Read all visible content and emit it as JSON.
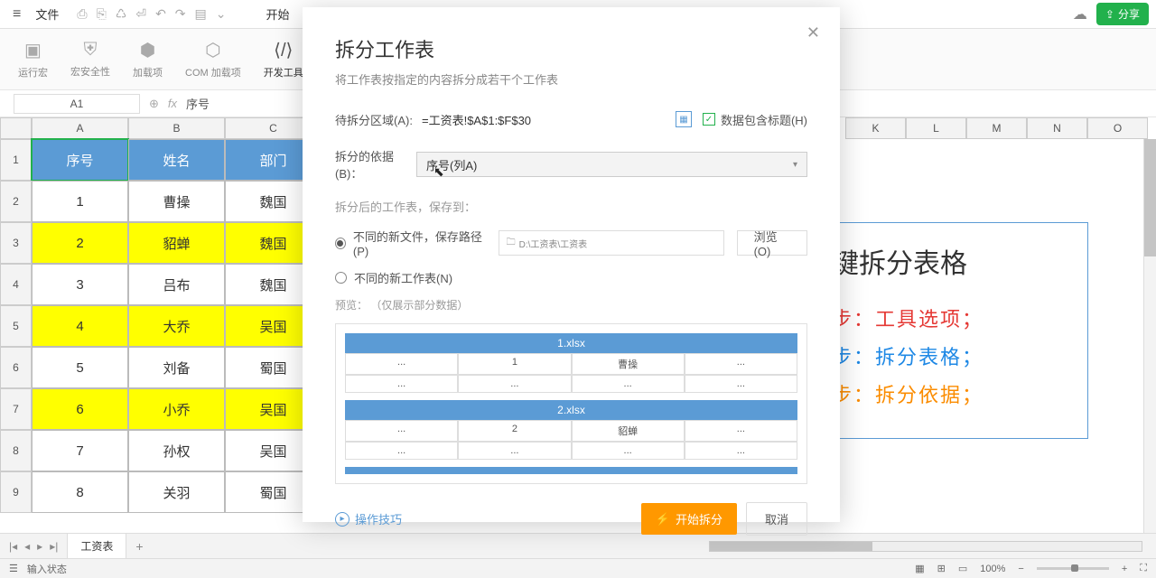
{
  "menubar": {
    "file": "文件",
    "start_tab": "开始",
    "share": "分享"
  },
  "ribbon": {
    "items": [
      {
        "label": "运行宏"
      },
      {
        "label": "宏安全性"
      },
      {
        "label": "加载项"
      },
      {
        "label": "COM 加载项"
      },
      {
        "label": "开发工具"
      }
    ]
  },
  "formula": {
    "name_box": "A1",
    "fx_label": "fx",
    "value": "序号"
  },
  "sheet": {
    "col_letters": [
      "A",
      "B",
      "C"
    ],
    "far_cols": [
      "K",
      "L",
      "M",
      "N",
      "O"
    ],
    "header_row": [
      "序号",
      "姓名",
      "部门"
    ],
    "rows": [
      {
        "n": 1,
        "cells": [
          "1",
          "曹操",
          "魏国"
        ],
        "yellow": false
      },
      {
        "n": 2,
        "cells": [
          "2",
          "貂蝉",
          "魏国"
        ],
        "yellow": true
      },
      {
        "n": 3,
        "cells": [
          "3",
          "吕布",
          "魏国"
        ],
        "yellow": false
      },
      {
        "n": 4,
        "cells": [
          "4",
          "大乔",
          "吴国"
        ],
        "yellow": true
      },
      {
        "n": 5,
        "cells": [
          "5",
          "刘备",
          "蜀国"
        ],
        "yellow": false
      },
      {
        "n": 6,
        "cells": [
          "6",
          "小乔",
          "吴国"
        ],
        "yellow": true
      },
      {
        "n": 7,
        "cells": [
          "7",
          "孙权",
          "吴国"
        ],
        "yellow": false
      },
      {
        "n": 8,
        "cells": [
          "8",
          "关羽",
          "蜀国"
        ],
        "yellow": false
      }
    ]
  },
  "annotation": {
    "title": "键拆分表格",
    "line1": "步：工具选项；",
    "line2": "步：拆分表格；",
    "line3": "步：拆分依据；"
  },
  "tabs": {
    "active": "工资表"
  },
  "status": {
    "left_icon": "☰",
    "text": "输入状态",
    "zoom": "100%"
  },
  "dialog": {
    "title": "拆分工作表",
    "subtitle": "将工作表按指定的内容拆分成若干个工作表",
    "range_label": "待拆分区域(A):",
    "range_value": "=工资表!$A$1:$F$30",
    "contains_header": "数据包含标题(H)",
    "basis_label": "拆分的依据(B)：",
    "basis_value": "序号(列A)",
    "save_to_label": "拆分后的工作表，保存到：",
    "radio1": "不同的新文件，保存路径(P)",
    "path_value": "D:\\工资表\\工资表",
    "browse": "浏览(O)",
    "radio2": "不同的新工作表(N)",
    "preview_label": "预览：  （仅展示部分数据）",
    "preview": [
      {
        "file": "1.xlsx",
        "r1": [
          "...",
          "1",
          "曹操",
          "..."
        ],
        "r2": [
          "...",
          "...",
          "...",
          "..."
        ]
      },
      {
        "file": "2.xlsx",
        "r1": [
          "...",
          "2",
          "貂蝉",
          "..."
        ],
        "r2": [
          "...",
          "...",
          "...",
          "..."
        ]
      }
    ],
    "tips": "操作技巧",
    "start": "开始拆分",
    "cancel": "取消"
  }
}
